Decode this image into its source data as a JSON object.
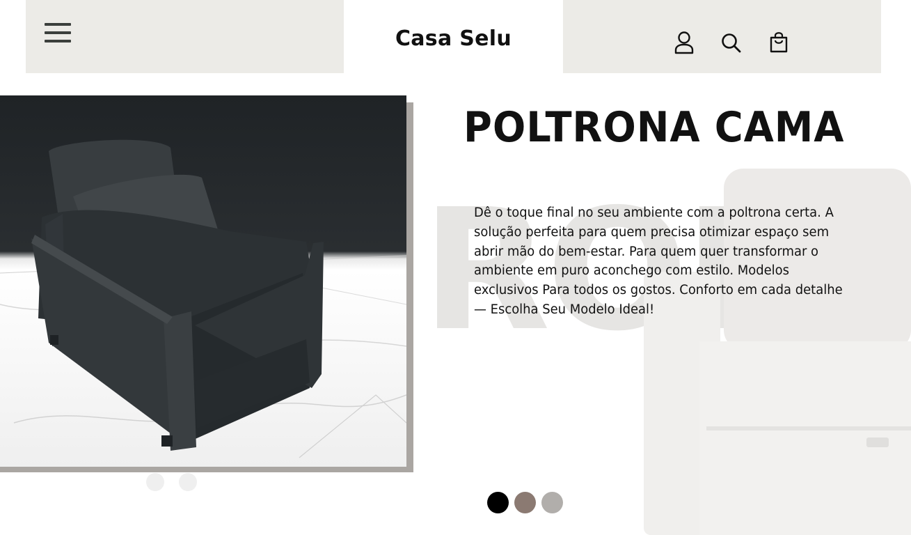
{
  "header": {
    "brand": "Casa Selu",
    "icons": [
      "menu-icon",
      "user-icon",
      "search-icon",
      "shopping-bag-icon"
    ]
  },
  "hero": {
    "title": "POLTRONA CAMA",
    "background_word": "RONA",
    "description": "Dê o toque final no seu ambiente com a poltrona certa. A solução perfeita para quem precisa otimizar espaço sem abrir mão do bem-estar. Para quem quer transformar o ambiente em puro aconchego com estilo. Modelos exclusivos Para todos os gostos. Conforto em cada detalhe — Escolha Seu Modelo Ideal!"
  },
  "color_options": [
    "#000000",
    "#8b7a72",
    "#b1aeab"
  ],
  "carousel": {
    "slides": 2,
    "active": 1
  },
  "colors": {
    "header_bg": "#ecebe7",
    "photo_shadow": "#aaa6a2",
    "menu_bars": "#3b3f3c"
  }
}
